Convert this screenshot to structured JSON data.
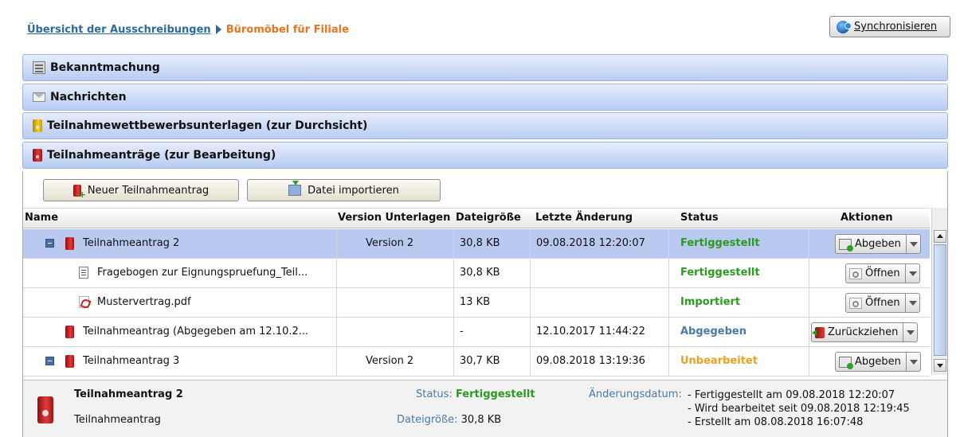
{
  "breadcrumb": {
    "parent": "Übersicht der Ausschreibungen",
    "current": "Büromöbel für Filiale"
  },
  "toolbar": {
    "sync_label": "Synchronisieren"
  },
  "accordion": [
    {
      "label": "Bekanntmachung",
      "icon": "news-icon"
    },
    {
      "label": "Nachrichten",
      "icon": "mail-icon"
    },
    {
      "label": "Teilnahmewettbewerbsunterlagen (zur Durchsicht)",
      "icon": "yellow-binder-icon"
    },
    {
      "label": "Teilnahmeanträge (zur Bearbeitung)",
      "icon": "red-binder-icon"
    }
  ],
  "actions": {
    "new_label": "Neuer Teilnahmeantrag",
    "import_label": "Datei importieren"
  },
  "table": {
    "columns": [
      "Name",
      "Version Unterlagen",
      "Dateigröße",
      "Letzte Änderung",
      "Status",
      "Aktionen"
    ],
    "rows": [
      {
        "name": "Teilnahmeantrag 2",
        "version": "Version 2",
        "size": "30,8 KB",
        "changed": "09.08.2018 12:20:07",
        "status": "Fertiggestellt",
        "action": "Abgeben"
      },
      {
        "name": "Fragebogen zur Eignungspruefung_Teil...",
        "version": "",
        "size": "30,8 KB",
        "changed": "",
        "status": "Fertiggestellt",
        "action": "Öffnen"
      },
      {
        "name": "Mustervertrag.pdf",
        "version": "",
        "size": "13 KB",
        "changed": "",
        "status": "Importiert",
        "action": "Öffnen"
      },
      {
        "name": "Teilnahmeantrag (Abgegeben am 12.10.2...",
        "version": "",
        "size": "-",
        "changed": "12.10.2017 11:44:22",
        "status": "Abgegeben",
        "action": "Zurückziehen"
      },
      {
        "name": "Teilnahmeantrag 3",
        "version": "Version 2",
        "size": "30,7 KB",
        "changed": "09.08.2018 13:19:36",
        "status": "Unbearbeitet",
        "action": "Abgeben"
      }
    ]
  },
  "details": {
    "title": "Teilnahmeantrag 2",
    "type": "Teilnahmeantrag",
    "status_label": "Status:",
    "status_value": "Fertiggestellt",
    "size_label": "Dateigröße:",
    "size_value": "30,8 KB",
    "date_label": "Änderungsdatum:",
    "history": [
      "- Fertiggestellt am 09.08.2018 12:20:07",
      "- Wird bearbeitet seit 09.08.2018 12:19:45",
      "- Erstellt am 08.08.2018 16:07:48"
    ]
  },
  "colors": {
    "accent_blue": "#2a6aa0",
    "breadcrumb_current": "#e8741c",
    "status_done": "#2b9a1f",
    "status_submitted": "#4a7aa6",
    "status_open": "#f0a020",
    "selection": "#b9c9ef"
  }
}
